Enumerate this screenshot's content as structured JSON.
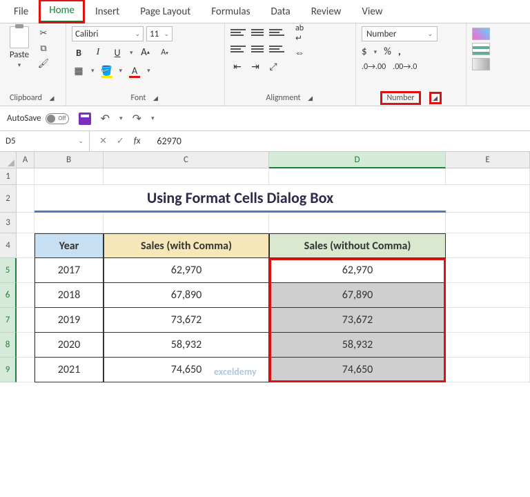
{
  "tabs": {
    "file": "File",
    "home": "Home",
    "insert": "Insert",
    "page_layout": "Page Layout",
    "formulas": "Formulas",
    "data": "Data",
    "review": "Review",
    "view": "View"
  },
  "clipboard": {
    "paste": "Paste",
    "group": "Clipboard"
  },
  "font": {
    "name": "Calibri",
    "size": "11",
    "group": "Font"
  },
  "alignment": {
    "group": "Alignment"
  },
  "number": {
    "format": "Number",
    "group": "Number"
  },
  "qat": {
    "autosave": "AutoSave",
    "autosave_state": "Off"
  },
  "fbar": {
    "namebox": "D5",
    "formula": "62970"
  },
  "cols": {
    "A": "A",
    "B": "B",
    "C": "C",
    "D": "D",
    "E": "E"
  },
  "rownums": [
    "1",
    "2",
    "3",
    "4",
    "5",
    "6",
    "7",
    "8",
    "9"
  ],
  "sheet": {
    "title": "Using Format Cells Dialog Box",
    "headers": {
      "year": "Year",
      "with": "Sales (with Comma)",
      "without": "Sales (without Comma)"
    },
    "rows": [
      {
        "year": "2017",
        "with": "62,970",
        "without": "62,970"
      },
      {
        "year": "2018",
        "with": "67,890",
        "without": "67,890"
      },
      {
        "year": "2019",
        "with": "73,672",
        "without": "73,672"
      },
      {
        "year": "2020",
        "with": "58,932",
        "without": "58,932"
      },
      {
        "year": "2021",
        "with": "74,650",
        "without": "74,650"
      }
    ]
  },
  "watermark": "exceldemy"
}
